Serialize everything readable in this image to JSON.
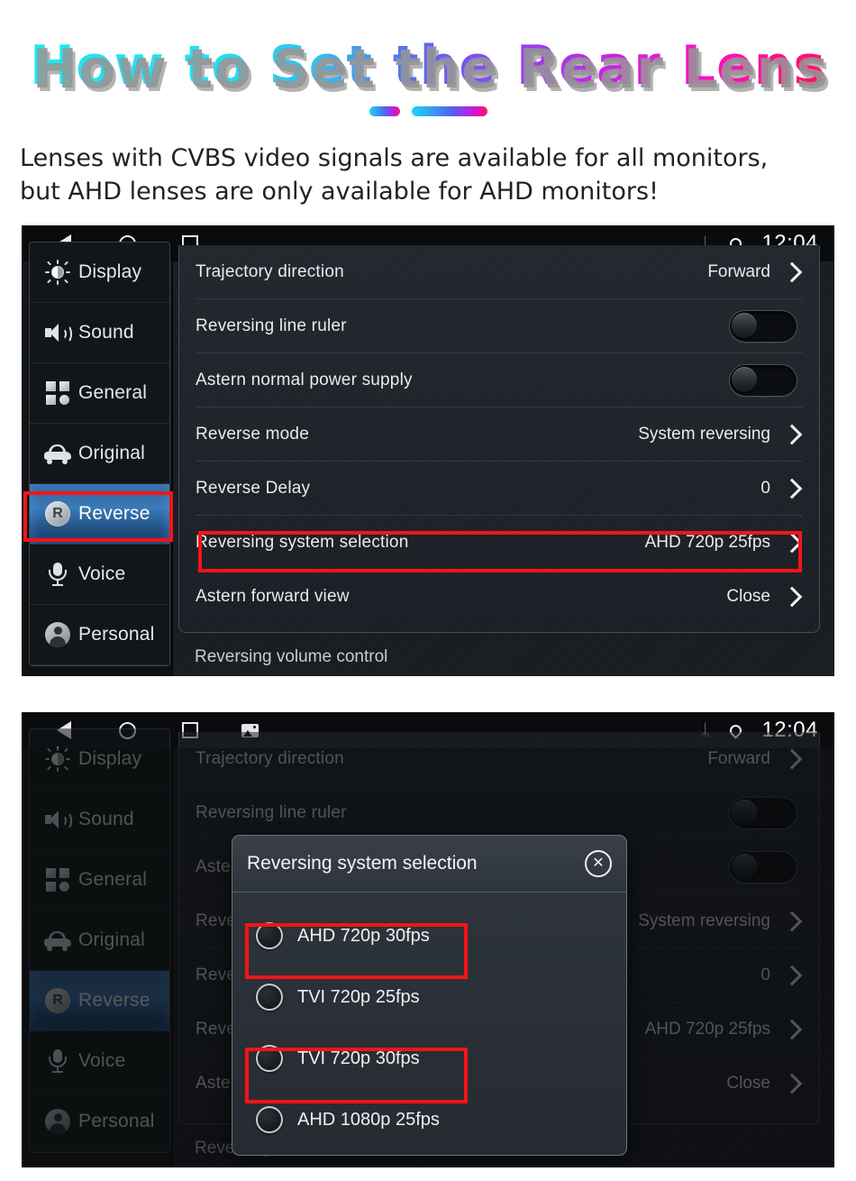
{
  "header": {
    "title": "How to Set the Rear Lens",
    "subtitle_line1": "Lenses with CVBS video signals are available for all monitors,",
    "subtitle_line2": "but AHD lenses are only available for AHD monitors!",
    "title_gradient_start": "#1de9f2",
    "title_gradient_end": "#ff1060",
    "divider_color": "#16d8f0"
  },
  "statusbar": {
    "back_icon": "back-triangle-icon",
    "home_icon": "home-circle-icon",
    "recents_icon": "recents-square-icon",
    "screenshot_icon": "screenshot-image-icon",
    "bluetooth_icon": "bluetooth-icon",
    "bluetooth_glyph": "ᛦ",
    "location_icon": "location-pin-icon",
    "time": "12:04"
  },
  "sidebar": {
    "items": [
      {
        "label": "Display",
        "icon": "brightness-sun-icon",
        "active": false
      },
      {
        "label": "Sound",
        "icon": "speaker-icon",
        "active": false
      },
      {
        "label": "General",
        "icon": "grid-squares-icon",
        "active": false
      },
      {
        "label": "Original",
        "icon": "car-icon",
        "active": false
      },
      {
        "label": "Reverse",
        "icon": "reverse-r-icon",
        "active": true
      },
      {
        "label": "Voice",
        "icon": "microphone-icon",
        "active": false
      },
      {
        "label": "Personal",
        "icon": "person-avatar-icon",
        "active": false
      }
    ]
  },
  "settings": {
    "rows": [
      {
        "label": "Trajectory direction",
        "value": "Forward",
        "control": "chevron"
      },
      {
        "label": "Reversing line ruler",
        "value": "",
        "control": "toggle",
        "toggle_on": false
      },
      {
        "label": "Astern normal power supply",
        "value": "",
        "control": "toggle",
        "toggle_on": false
      },
      {
        "label": "Reverse mode",
        "value": "System reversing",
        "control": "chevron"
      },
      {
        "label": "Reverse Delay",
        "value": "0",
        "control": "chevron"
      },
      {
        "label": "Reversing system selection",
        "value": "AHD 720p 25fps",
        "control": "chevron",
        "highlighted": true
      },
      {
        "label": "Astern forward view",
        "value": "Close",
        "control": "chevron"
      }
    ],
    "partial_row_label": "Reversing volume control"
  },
  "dialog": {
    "title": "Reversing system selection",
    "close_icon": "close-x-icon",
    "close_glyph": "✕",
    "options": [
      {
        "label": "AHD 720p 30fps",
        "selected": false,
        "highlighted": false
      },
      {
        "label": "TVI 720p 25fps",
        "selected": false,
        "highlighted": true
      },
      {
        "label": "TVI 720p 30fps",
        "selected": false,
        "highlighted": false
      },
      {
        "label": "AHD 1080p 25fps",
        "selected": false,
        "highlighted": true
      }
    ]
  },
  "highlight_color": "#f41418"
}
